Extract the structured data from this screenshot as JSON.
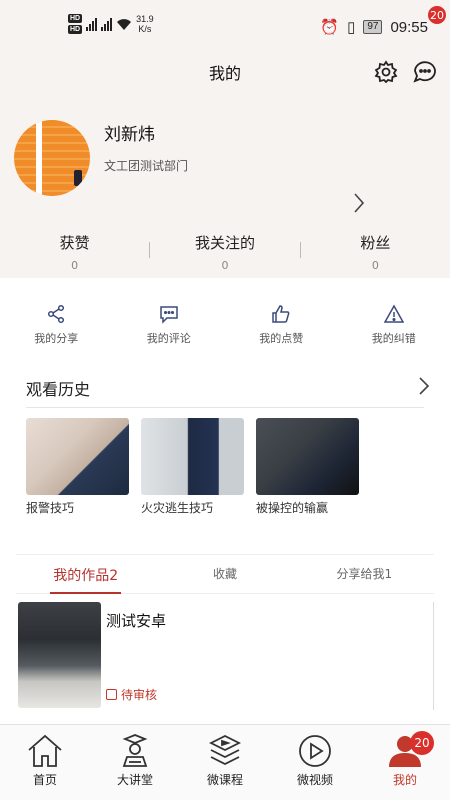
{
  "status_bar": {
    "hd1": "HD",
    "hd2": "HD",
    "net_speed_value": "31.9",
    "net_speed_unit": "K/s",
    "battery": "97",
    "time": "09:55"
  },
  "header": {
    "title": "我的",
    "message_badge": "20"
  },
  "profile": {
    "name": "刘新炜",
    "department": "文工团测试部门"
  },
  "stats": [
    {
      "label": "获赞",
      "value": "0"
    },
    {
      "label": "我关注的",
      "value": "0"
    },
    {
      "label": "粉丝",
      "value": "0"
    }
  ],
  "actions": [
    {
      "label": "我的分享",
      "icon": "share-icon"
    },
    {
      "label": "我的评论",
      "icon": "comment-icon"
    },
    {
      "label": "我的点赞",
      "icon": "thumbs-up-icon"
    },
    {
      "label": "我的纠错",
      "icon": "warning-icon"
    }
  ],
  "history": {
    "title": "观看历史",
    "items": [
      {
        "label": "报警技巧"
      },
      {
        "label": "火灾逃生技巧"
      },
      {
        "label": "被操控的输赢"
      }
    ]
  },
  "tabs": [
    {
      "label": "我的作品2",
      "active": true
    },
    {
      "label": "收藏",
      "active": false
    },
    {
      "label": "分享给我1",
      "active": false
    }
  ],
  "works": [
    {
      "title": "测试安卓",
      "status": "待审核"
    }
  ],
  "bottom_nav": {
    "items": [
      {
        "label": "首页",
        "icon": "home-icon"
      },
      {
        "label": "大讲堂",
        "icon": "lecture-icon"
      },
      {
        "label": "微课程",
        "icon": "course-icon"
      },
      {
        "label": "微视频",
        "icon": "video-icon"
      },
      {
        "label": "我的",
        "icon": "profile-icon",
        "active": true
      }
    ],
    "profile_badge": "20"
  },
  "colors": {
    "accent": "#c0392b",
    "badge": "#d9302c",
    "header_bg": "#f7f3f1"
  }
}
